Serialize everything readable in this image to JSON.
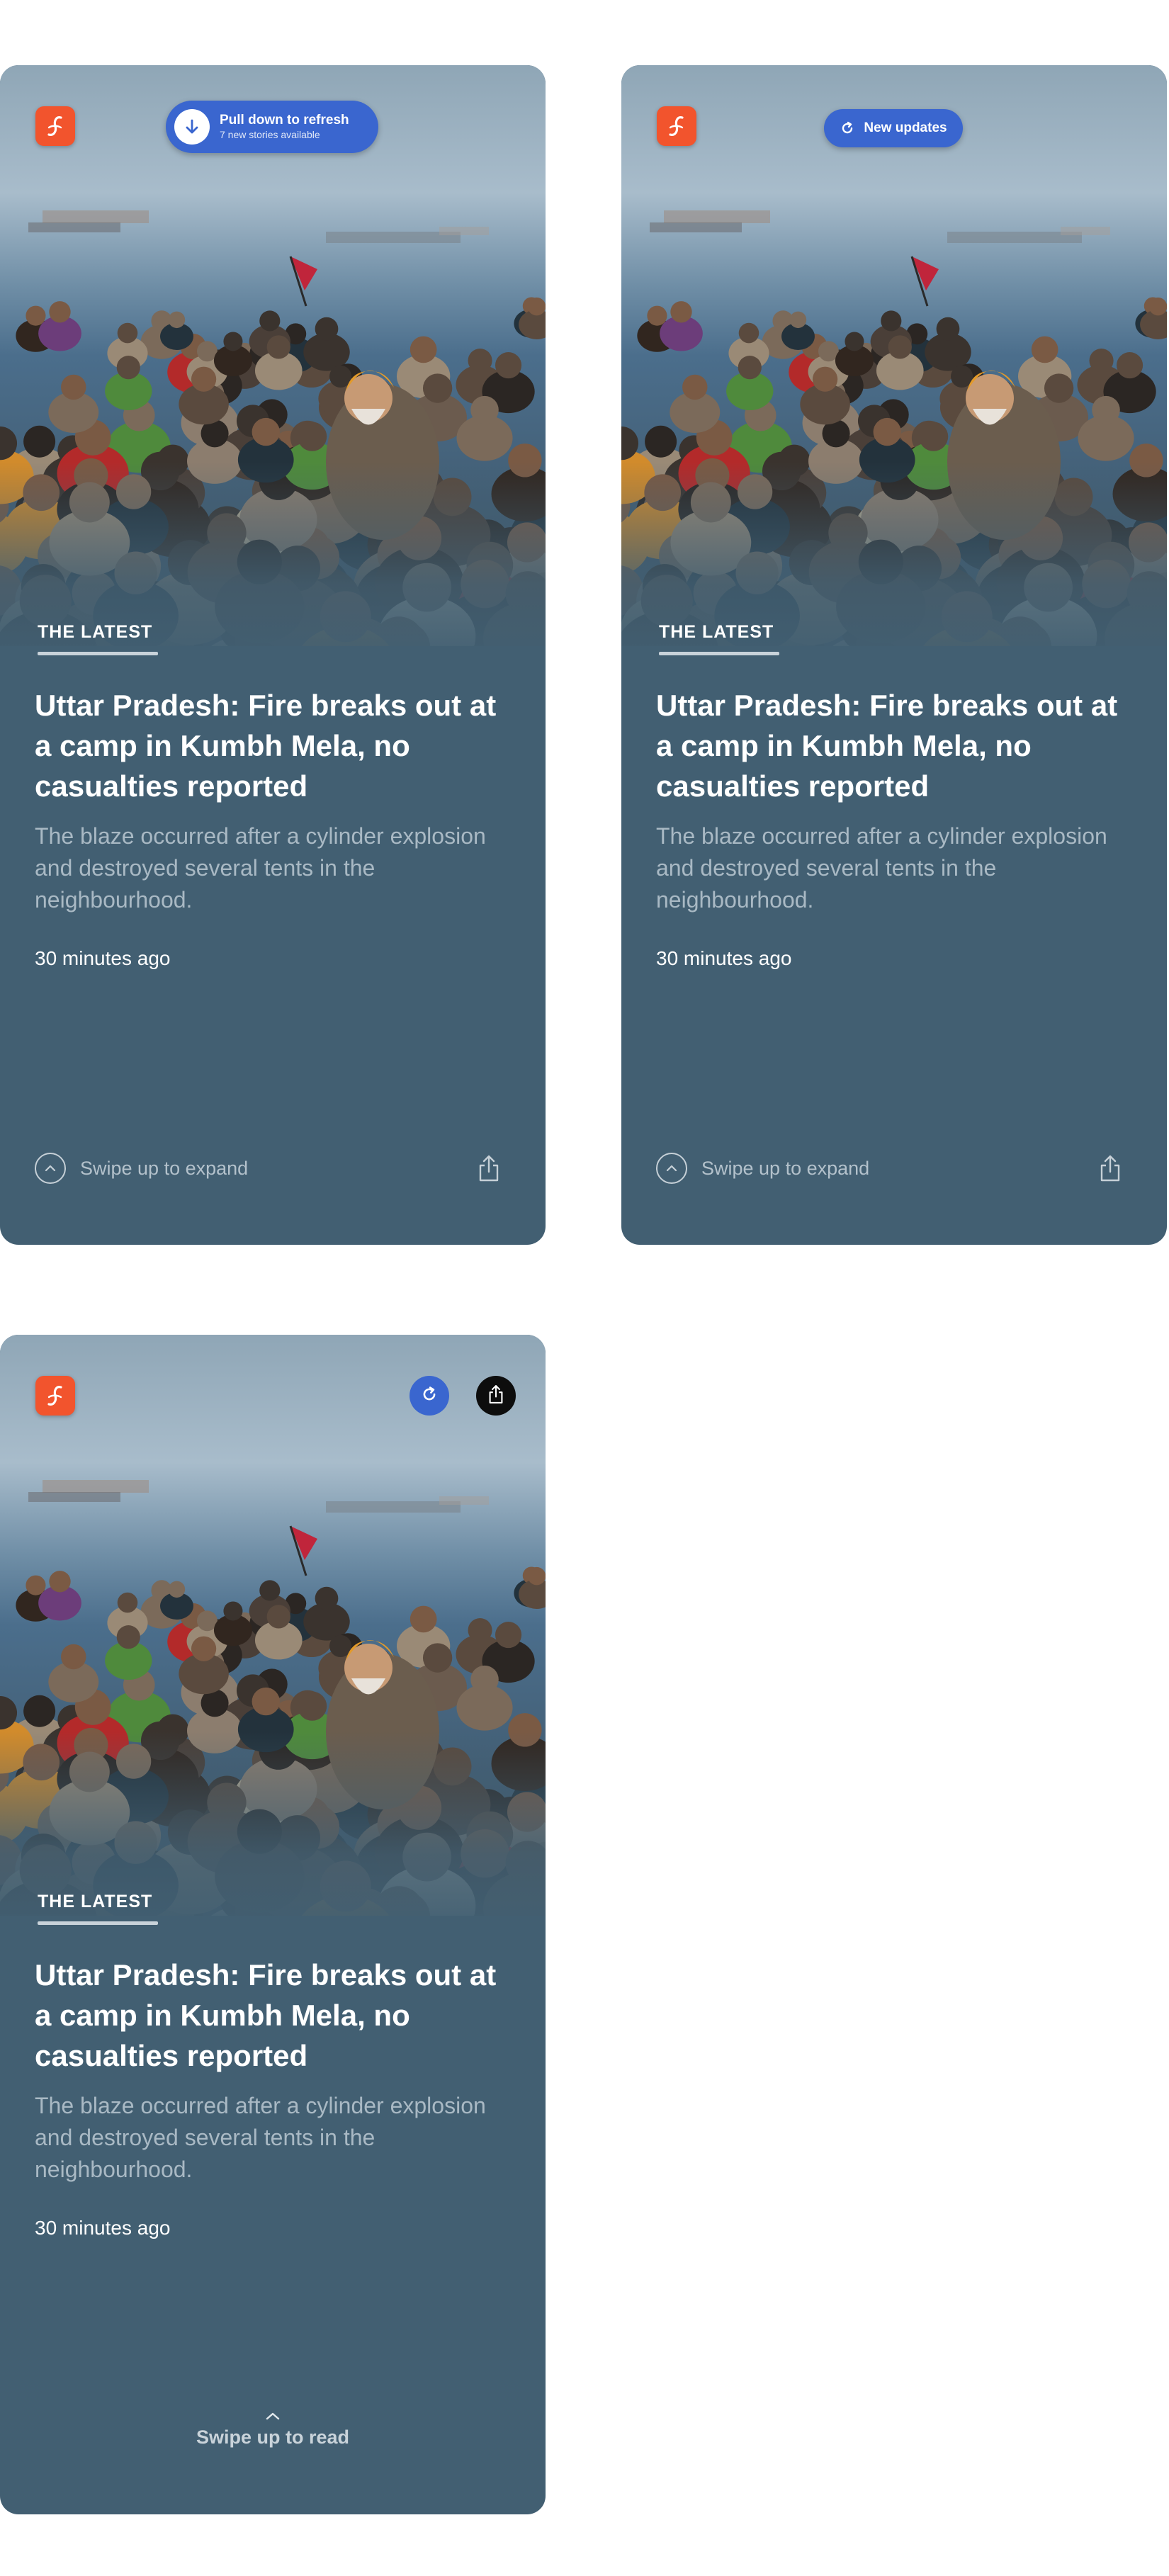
{
  "brand": {
    "logo": "logo-icon",
    "logo_color": "#f2542d",
    "accent": "#3a66cf",
    "card_bg": "#425f72"
  },
  "cards": [
    {
      "variant": "pull-to-refresh",
      "pill": {
        "title": "Pull down to refresh",
        "subtitle": "7 new stories available",
        "icon": "arrow-down-icon"
      },
      "section": "THE LATEST",
      "headline": "Uttar Pradesh: Fire breaks out at a camp in Kumbh Mela, no casualties reported",
      "dek": "The blaze occurred after a cylinder explosion and destroyed several tents in the neighbourhood.",
      "time": "30 minutes ago",
      "footer": {
        "swipe_label": "Swipe up to expand",
        "icons": [
          "chevron-up-icon",
          "share-icon"
        ]
      }
    },
    {
      "variant": "new-updates",
      "pill": {
        "title": "New updates",
        "icon": "refresh-icon"
      },
      "section": "THE LATEST",
      "headline": "Uttar Pradesh: Fire breaks out at a camp in Kumbh Mela, no casualties reported",
      "dek": "The blaze occurred after a cylinder explosion and destroyed several tents in the neighbourhood.",
      "time": "30 minutes ago",
      "footer": {
        "swipe_label": "Swipe up to expand",
        "icons": [
          "chevron-up-icon",
          "share-icon"
        ]
      }
    },
    {
      "variant": "buttons",
      "top_icons": [
        "refresh-icon",
        "share-icon"
      ],
      "section": "THE LATEST",
      "headline": "Uttar Pradesh: Fire breaks out at a camp in Kumbh Mela, no casualties reported",
      "dek": "The blaze occurred after a cylinder explosion and destroyed several tents in the neighbourhood.",
      "time": "30 minutes ago",
      "footer": {
        "swipe_label": "Swipe up to read",
        "icons": [
          "chevron-up-icon"
        ]
      }
    }
  ]
}
